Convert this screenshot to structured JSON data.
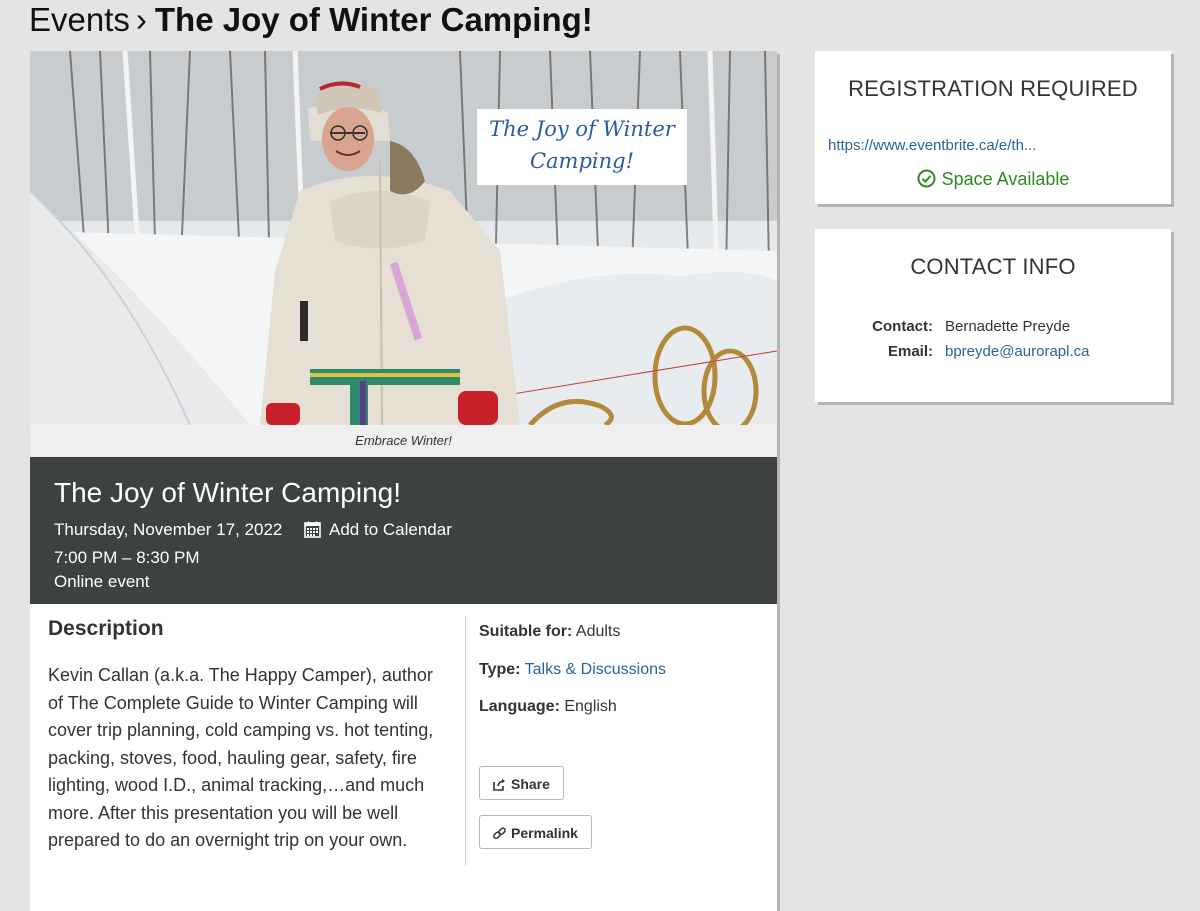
{
  "breadcrumb": {
    "parent": "Events",
    "separator": "›",
    "current": "The Joy of Winter Camping!"
  },
  "hero": {
    "overlay_line1": "The Joy of Winter",
    "overlay_line2": "Camping!",
    "caption": "Embrace Winter!"
  },
  "event": {
    "title": "The Joy of Winter Camping!",
    "date": "Thursday, November 17, 2022",
    "add_to_calendar": "Add to Calendar",
    "time": "7:00 PM – 8:30 PM",
    "location": "Online event"
  },
  "description": {
    "heading": "Description",
    "body": "Kevin Callan (a.k.a. The Happy Camper), author of The Complete Guide to Winter Camping will cover trip planning, cold camping vs. hot tenting, packing, stoves, food, hauling gear, safety, fire lighting, wood I.D., animal tracking,…and much more. After this presentation you will be well prepared to do an overnight trip on your own."
  },
  "meta": {
    "suitable_label": "Suitable for:",
    "suitable_value": "Adults",
    "type_label": "Type:",
    "type_value": "Talks & Discussions",
    "language_label": "Language:",
    "language_value": "English"
  },
  "actions": {
    "share": "Share",
    "permalink": "Permalink"
  },
  "registration": {
    "heading": "REGISTRATION REQUIRED",
    "link": "https://www.eventbrite.ca/e/th...",
    "status": "Space Available"
  },
  "contact": {
    "heading": "CONTACT INFO",
    "contact_label": "Contact:",
    "contact_value": "Bernadette Preyde",
    "email_label": "Email:",
    "email_value": "bpreyde@aurorapl.ca"
  },
  "colors": {
    "banner_bg": "#3d4142",
    "link": "#2a6496",
    "available": "#2d8a1e",
    "page_bg": "#e4e4e4"
  },
  "icons": {
    "calendar": "calendar-icon",
    "share": "share-icon",
    "permalink": "link-icon",
    "status": "check-circle-icon"
  }
}
